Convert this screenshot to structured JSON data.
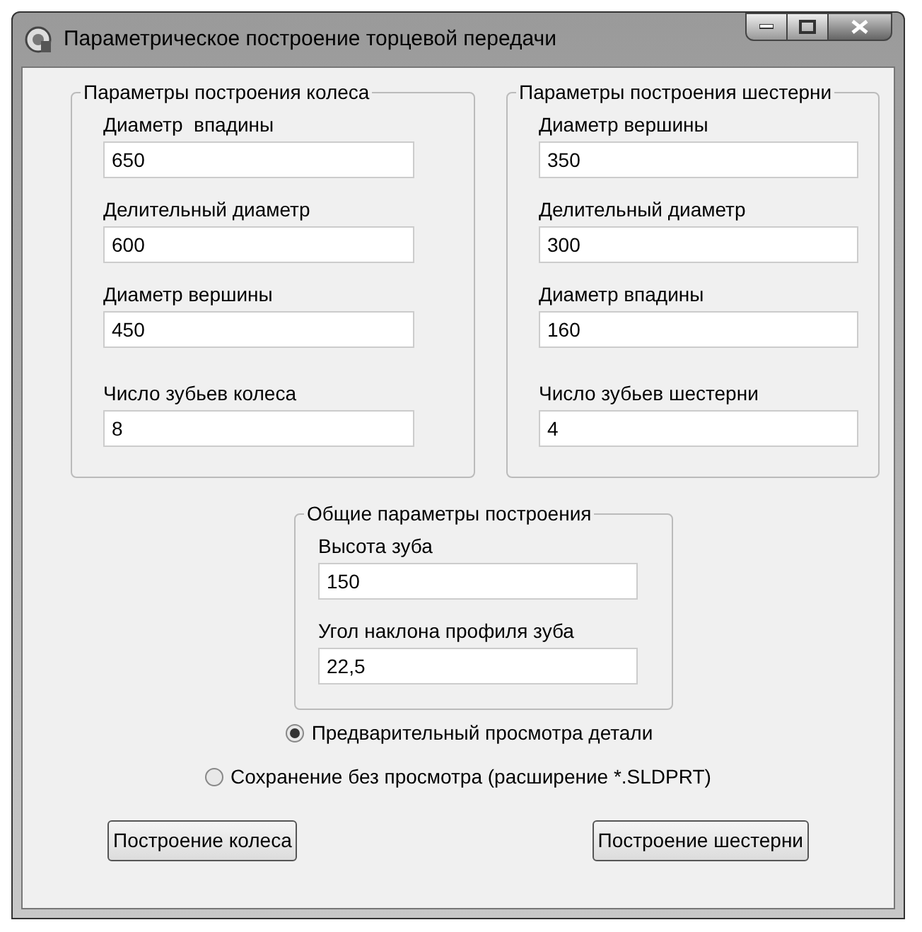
{
  "window": {
    "title": "Параметрическое построение торцевой передачи"
  },
  "groups": [
    {
      "title": "Параметры построения колеса",
      "fields": [
        {
          "label": "Диаметр  впадины",
          "value": "650"
        },
        {
          "label": "Делительный диаметр",
          "value": "600"
        },
        {
          "label": "Диаметр вершины",
          "value": "450"
        },
        {
          "label": "Число зубьев колеса",
          "value": "8"
        }
      ]
    },
    {
      "title": "Параметры построения шестерни",
      "fields": [
        {
          "label": "Диаметр вершины",
          "value": "350"
        },
        {
          "label": "Делительный диаметр",
          "value": "300"
        },
        {
          "label": "Диаметр впадины",
          "value": "160"
        },
        {
          "label": "Число зубьев шестерни",
          "value": "4"
        }
      ]
    },
    {
      "title": "Общие параметры построения",
      "fields": [
        {
          "label": "Высота зуба",
          "value": "150"
        },
        {
          "label": "Угол наклона профиля зуба",
          "value": "22,5"
        }
      ]
    }
  ],
  "radios": [
    {
      "label": "Предварительный просмотра детали",
      "selected": true
    },
    {
      "label": "Сохранение без просмотра (расширение *.SLDPRT)",
      "selected": false
    }
  ],
  "buttons": [
    "Построение колеса",
    "Построение шестерни"
  ]
}
